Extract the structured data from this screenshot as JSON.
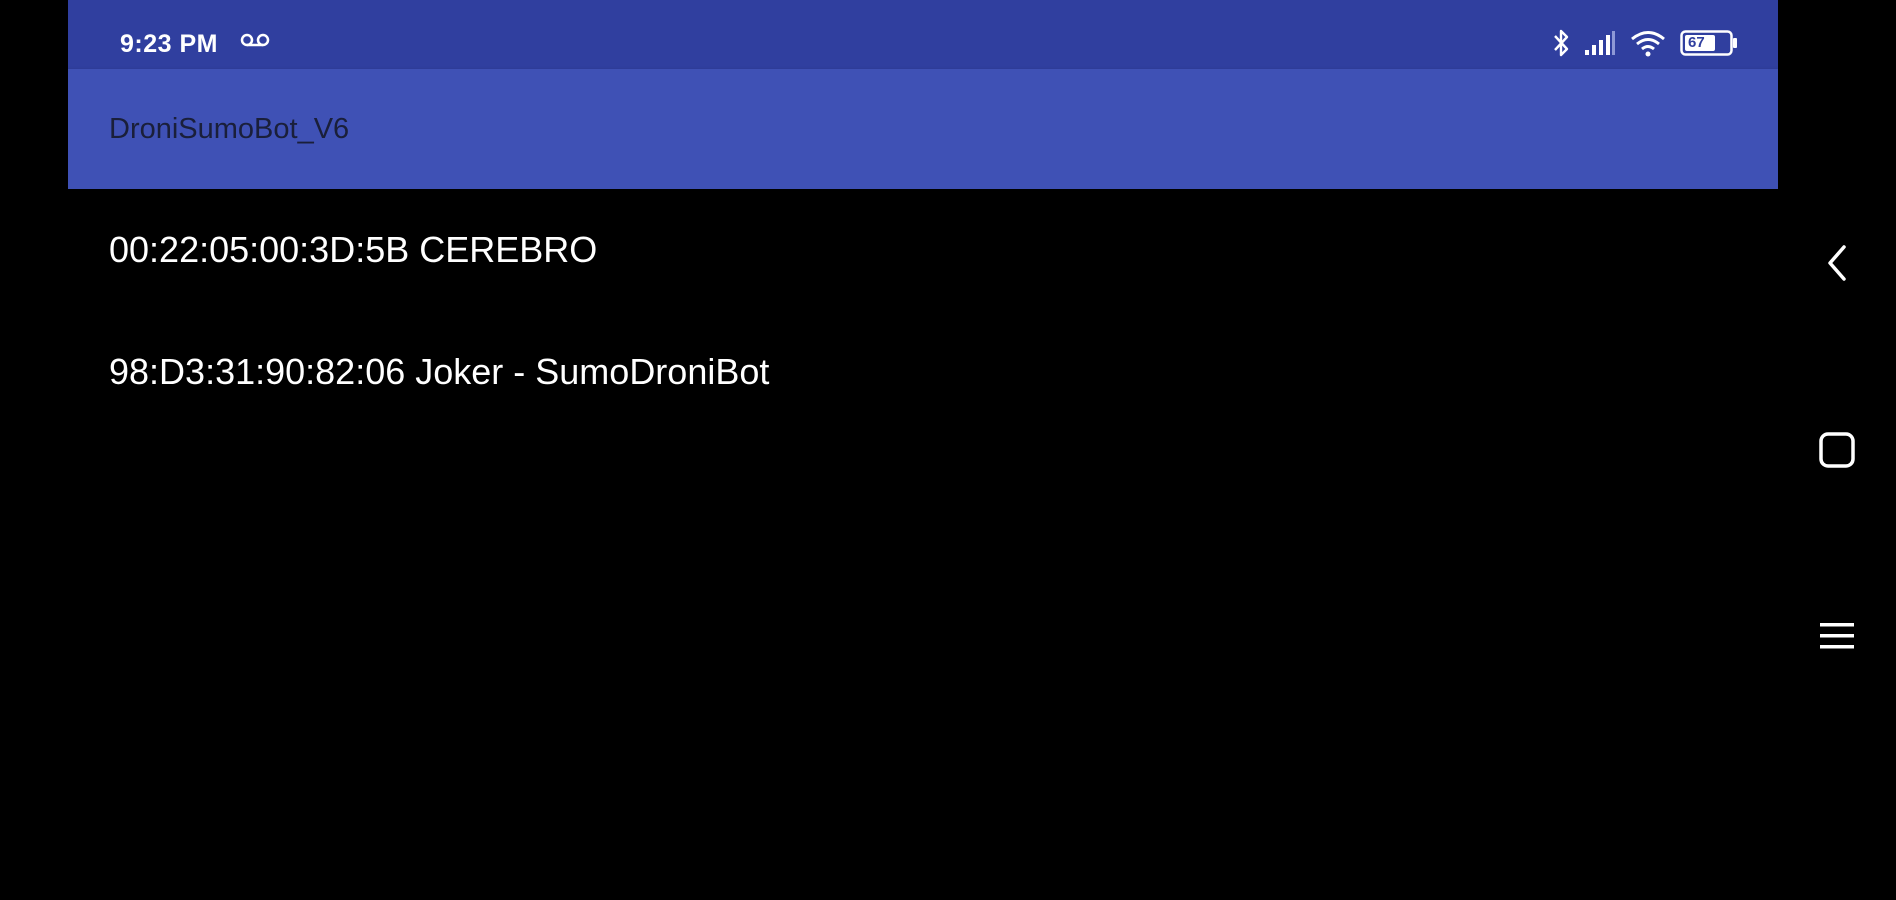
{
  "status_bar": {
    "time": "9:23 PM",
    "battery_level": "67",
    "background_color": "#303f9f",
    "icons": [
      "voicemail-icon",
      "bluetooth-icon",
      "cell-signal-icon",
      "wifi-icon",
      "battery-icon"
    ]
  },
  "app_bar": {
    "title": "DroniSumoBot_V6",
    "background_color": "#3f51b5"
  },
  "device_list": {
    "items": [
      {
        "label": "00:22:05:00:3D:5B CEREBRO"
      },
      {
        "label": "98:D3:31:90:82:06 Joker - SumoDroniBot"
      }
    ]
  },
  "nav_bar": {
    "buttons": [
      "back-icon",
      "home-icon",
      "menu-icon"
    ]
  }
}
